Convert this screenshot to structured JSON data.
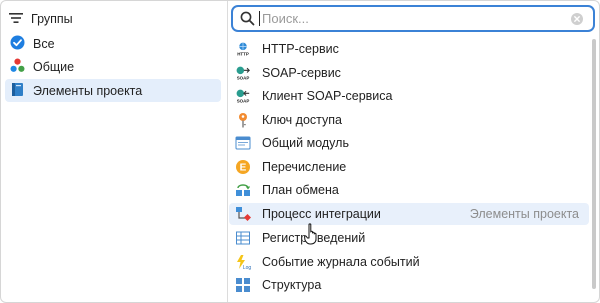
{
  "groups_panel": {
    "header_label": "Группы",
    "items": [
      {
        "label": "Все",
        "icon": "check-circle-icon"
      },
      {
        "label": "Общие",
        "icon": "common-objects-icon"
      },
      {
        "label": "Элементы проекта",
        "icon": "project-elements-icon",
        "selected": true
      }
    ]
  },
  "search": {
    "placeholder": "Поиск...",
    "value": ""
  },
  "items": [
    {
      "label": "HTTP-сервис",
      "icon": "http-service-icon"
    },
    {
      "label": "SOAP-сервис",
      "icon": "soap-service-icon"
    },
    {
      "label": "Клиент SOAP-сервиса",
      "icon": "soap-client-icon"
    },
    {
      "label": "Ключ доступа",
      "icon": "access-key-icon"
    },
    {
      "label": "Общий модуль",
      "icon": "common-module-icon"
    },
    {
      "label": "Перечисление",
      "icon": "enumeration-icon"
    },
    {
      "label": "План обмена",
      "icon": "exchange-plan-icon"
    },
    {
      "label": "Процесс интеграции",
      "icon": "integration-process-icon",
      "group": "Элементы проекта",
      "hover": true
    },
    {
      "label": "Регистр сведений",
      "icon": "info-register-icon"
    },
    {
      "label": "Событие журнала событий",
      "icon": "event-log-icon"
    },
    {
      "label": "Структура",
      "icon": "structure-icon"
    }
  ],
  "colors": {
    "accent": "#3b82d6",
    "selected_bg": "#e4eefb",
    "hover_bg": "#e8f0fb"
  }
}
